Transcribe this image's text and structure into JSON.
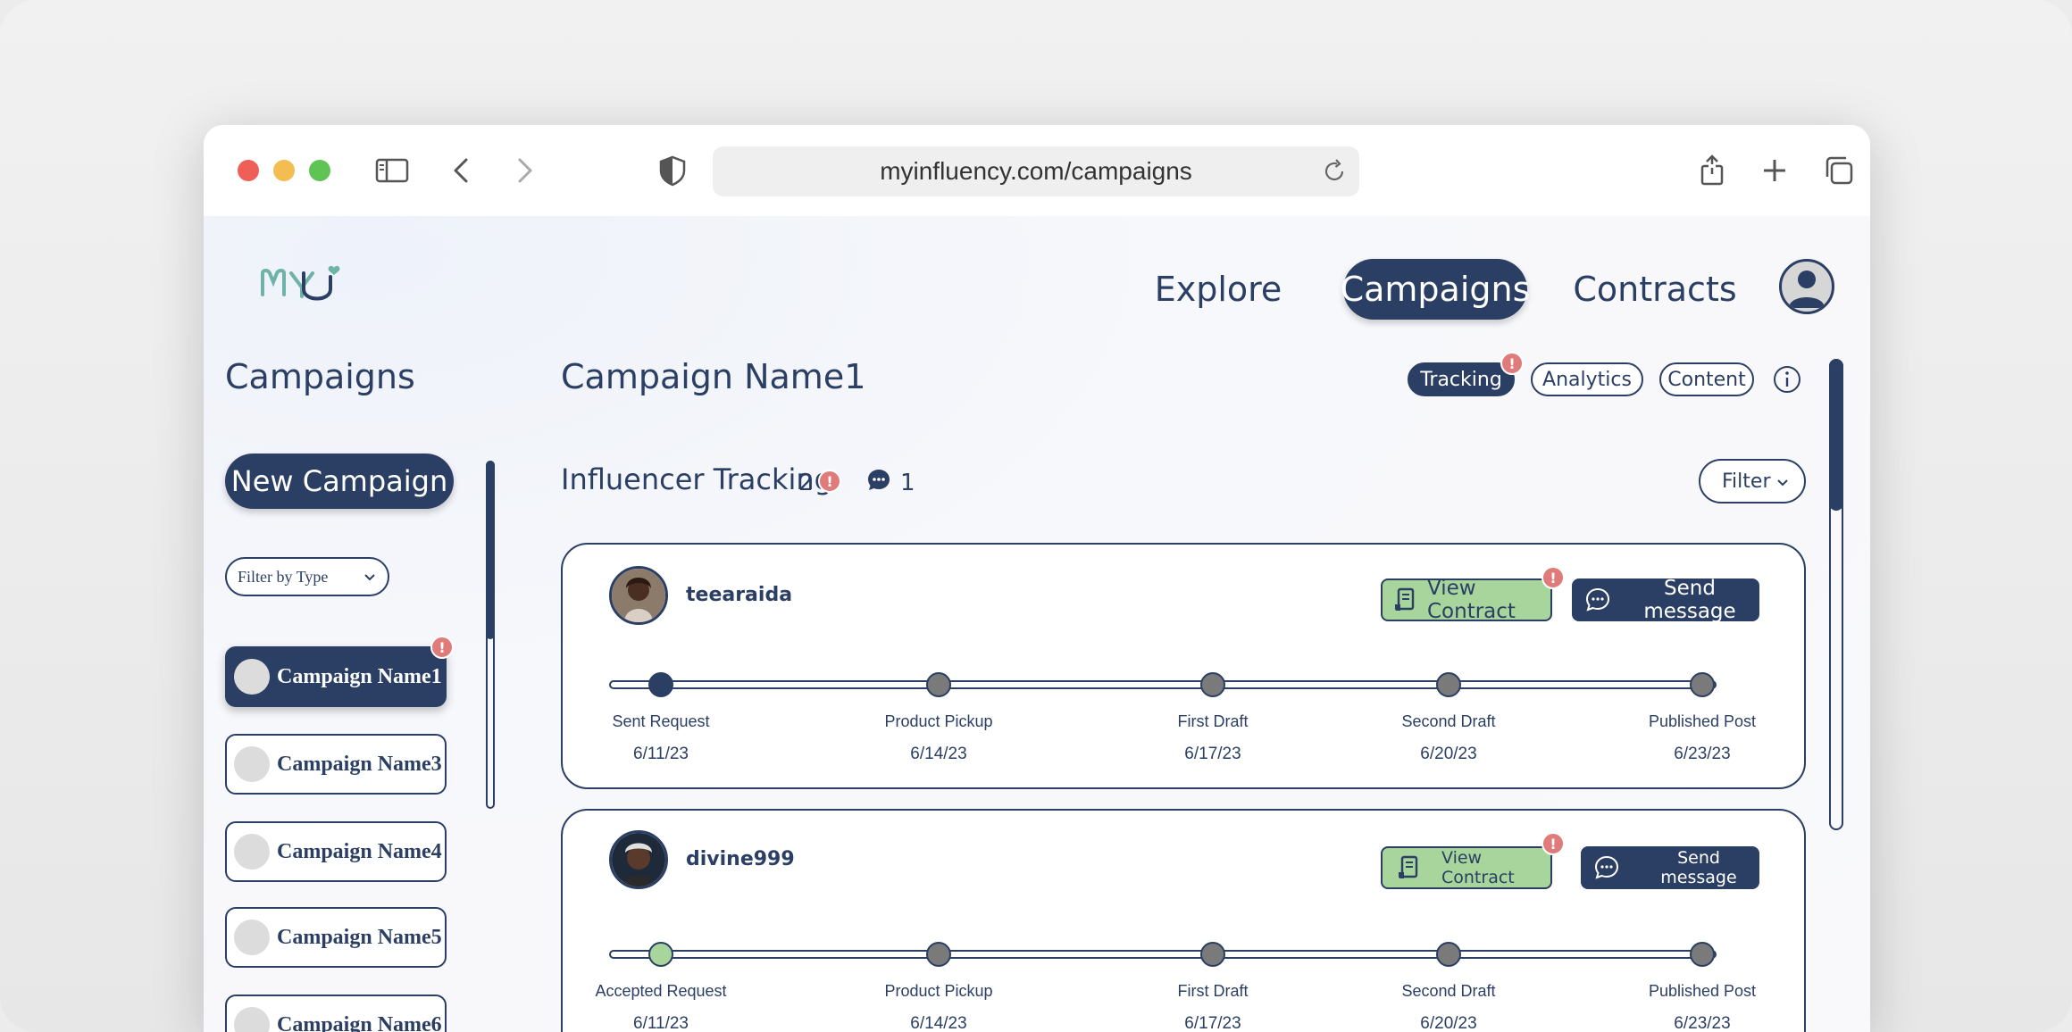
{
  "browser": {
    "url": "myinfluency.com/campaigns"
  },
  "nav": {
    "logo_text": "mYU",
    "items": [
      {
        "label": "Explore"
      },
      {
        "label": "Campaigns"
      },
      {
        "label": "Contracts"
      }
    ],
    "active": "Campaigns"
  },
  "sidebar": {
    "title": "Campaigns",
    "new_button": "New Campaign",
    "filter_label": "Filter by Type",
    "items": [
      {
        "label": "Campaign Name1",
        "active": true,
        "alert": "!"
      },
      {
        "label": "Campaign Name3"
      },
      {
        "label": "Campaign Name4"
      },
      {
        "label": "Campaign Name5"
      },
      {
        "label": "Campaign Name6"
      }
    ]
  },
  "main": {
    "title": "Campaign Name1",
    "tabs": [
      {
        "label": "Tracking",
        "active": true,
        "alert": "!"
      },
      {
        "label": "Analytics"
      },
      {
        "label": "Content"
      }
    ],
    "section": {
      "title": "Influencer Tracking",
      "count": "2",
      "alert": "!",
      "message_count": "1",
      "filter_label": "Filter"
    },
    "cards": [
      {
        "username": "teearaida",
        "contract_button": "View Contract",
        "contract_alert": "!",
        "message_button": "Send message",
        "progress_step": 1,
        "steps": [
          {
            "label": "Sent Request",
            "date": "6/11/23"
          },
          {
            "label": "Product Pickup",
            "date": "6/14/23"
          },
          {
            "label": "First Draft",
            "date": "6/17/23"
          },
          {
            "label": "Second Draft",
            "date": "6/20/23"
          },
          {
            "label": "Published Post",
            "date": "6/23/23"
          }
        ]
      },
      {
        "username": "divine999",
        "contract_button": "View Contract",
        "contract_alert": "!",
        "message_button": "Send message",
        "progress_step": 1,
        "steps": [
          {
            "label": "Accepted Request",
            "date": "6/11/23"
          },
          {
            "label": "Product Pickup",
            "date": "6/14/23"
          },
          {
            "label": "First Draft",
            "date": "6/17/23"
          },
          {
            "label": "Second Draft",
            "date": "6/20/23"
          },
          {
            "label": "Published Post",
            "date": "6/23/23"
          }
        ]
      }
    ]
  },
  "colors": {
    "primary": "#2b3e63",
    "accent_green": "#a8d59b",
    "alert": "#e07b7b",
    "logo_teal": "#6fb3a8"
  }
}
